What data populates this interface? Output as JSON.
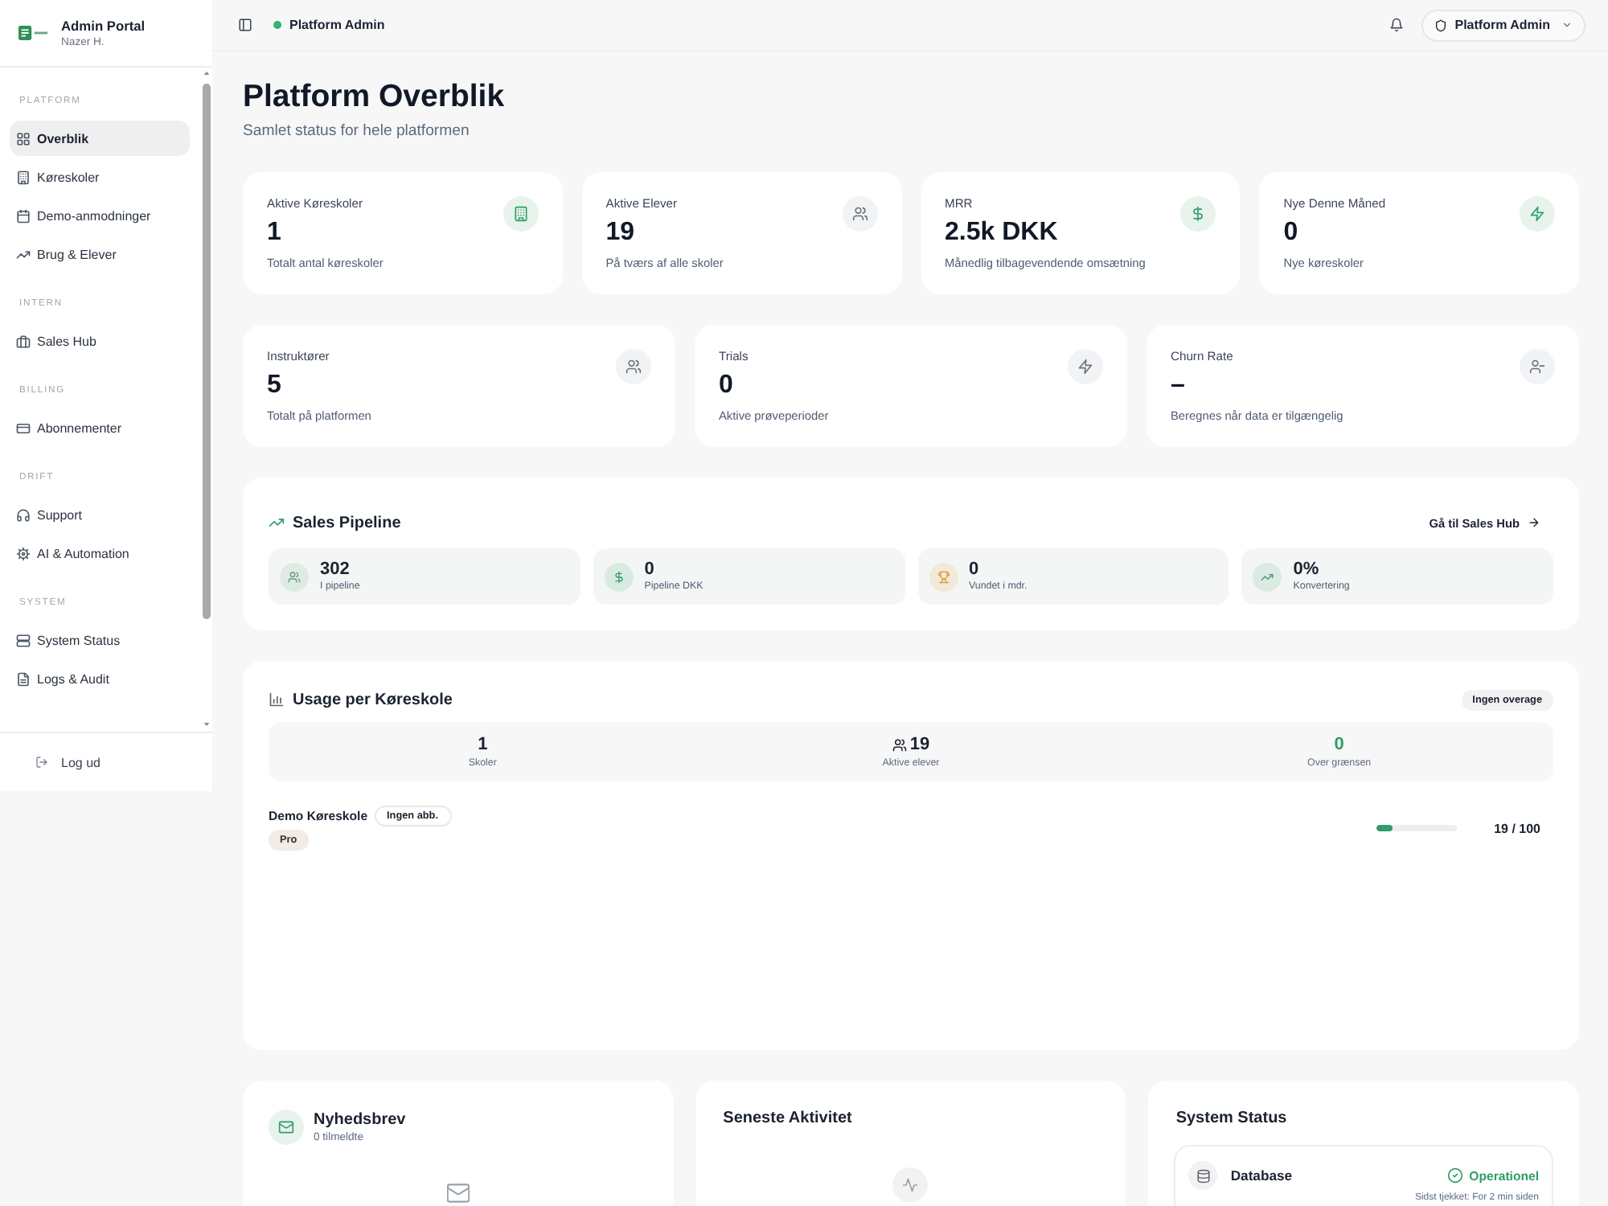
{
  "sidebar": {
    "brand": {
      "title": "Admin Portal",
      "user": "Nazer H."
    },
    "sections": [
      {
        "label": "PLATFORM",
        "items": [
          {
            "label": "Overblik",
            "selected": true
          },
          {
            "label": "Køreskoler",
            "selected": false
          },
          {
            "label": "Demo-anmodninger",
            "selected": false
          },
          {
            "label": "Brug & Elever",
            "selected": false
          }
        ]
      },
      {
        "label": "INTERN",
        "items": [
          {
            "label": "Sales Hub",
            "selected": false
          }
        ]
      },
      {
        "label": "BILLING",
        "items": [
          {
            "label": "Abonnementer",
            "selected": false
          }
        ]
      },
      {
        "label": "DRIFT",
        "items": [
          {
            "label": "Support",
            "selected": false
          },
          {
            "label": "AI & Automation",
            "selected": false
          }
        ]
      },
      {
        "label": "SYSTEM",
        "items": [
          {
            "label": "System Status",
            "selected": false
          },
          {
            "label": "Logs & Audit",
            "selected": false
          }
        ]
      }
    ],
    "logout": "Log ud"
  },
  "topbar": {
    "role": "Platform Admin",
    "online": true,
    "account": "Platform Admin"
  },
  "page": {
    "title": "Platform Overblik",
    "subtitle": "Samlet status for hele platformen"
  },
  "stat_rows": [
    {
      "cards": [
        {
          "label": "Aktive Køreskoler",
          "value": "1",
          "note": "Totalt antal køreskoler",
          "accent": true
        },
        {
          "label": "Aktive Elever",
          "value": "19",
          "note": "På tværs af alle skoler",
          "accent": false
        },
        {
          "label": "MRR",
          "value": "2.5k DKK",
          "note": "Månedlig tilbagevendende omsætning",
          "accent": true
        },
        {
          "label": "Nye Denne Måned",
          "value": "0",
          "note": "Nye køreskoler",
          "accent": true
        }
      ]
    },
    {
      "cards": [
        {
          "label": "Instruktører",
          "value": "5",
          "note": "Totalt på platformen",
          "accent": false
        },
        {
          "label": "Trials",
          "value": "0",
          "note": "Aktive prøveperioder",
          "accent": false
        },
        {
          "label": "Churn Rate",
          "value": "–",
          "note": "Beregnes når data er tilgængelig",
          "accent": false
        }
      ]
    }
  ],
  "sales_pipeline": {
    "title": "Sales Pipeline",
    "link": "Gå til Sales Hub",
    "metrics": [
      {
        "value": "302",
        "label": "I pipeline",
        "color": "#5f9e7c"
      },
      {
        "value": "0",
        "label": "Pipeline DKK",
        "color": "#2f9e6a"
      },
      {
        "value": "0",
        "label": "Vundet i mdr.",
        "color": "#e0962e"
      },
      {
        "value": "0%",
        "label": "Konvertering",
        "color": "#3f9a6c"
      }
    ]
  },
  "usage": {
    "title": "Usage per Køreskole",
    "badge": "Ingen overage",
    "summary": [
      {
        "kind": "count",
        "value": "1",
        "label": "Skoler"
      },
      {
        "kind": "students",
        "value": "19",
        "label": "Aktive elever"
      },
      {
        "kind": "over",
        "value": "0",
        "label": "Over grænsen"
      }
    ],
    "schools": [
      {
        "name": "Demo Køreskole",
        "subscription": "Ingen abb.",
        "plan": "Pro",
        "level": 0.19,
        "reading": "19 / 100"
      }
    ]
  },
  "newsletter": {
    "title": "Nyhedsbrev",
    "subtitle": "0 tilmeldte"
  },
  "activity": {
    "title": "Seneste Aktivitet"
  },
  "system_status": {
    "title": "System Status",
    "services": [
      {
        "name": "Database",
        "status": "Operationel",
        "healthy": true,
        "last_check": "Sidst tjekket: For 2 min siden"
      }
    ]
  }
}
